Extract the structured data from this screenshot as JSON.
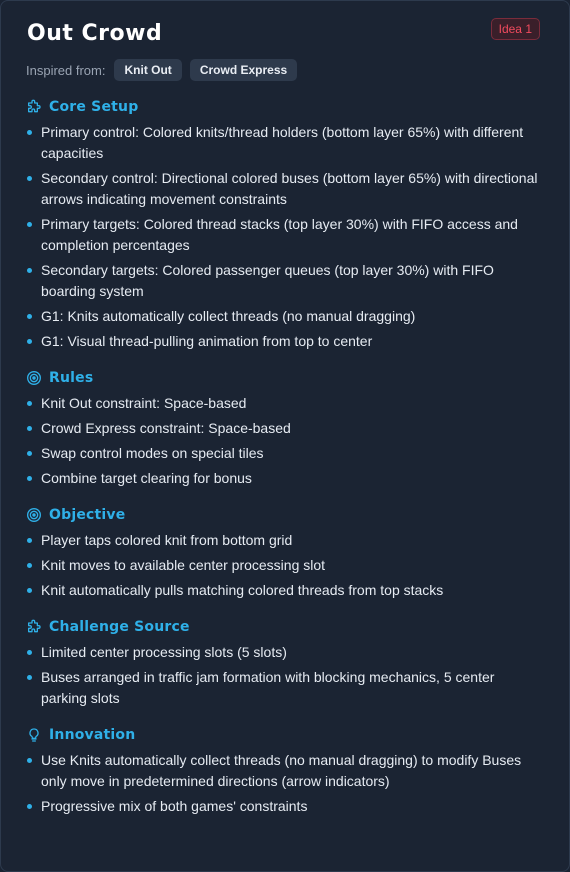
{
  "header": {
    "title": "Out Crowd",
    "badge": "Idea 1"
  },
  "inspired": {
    "label": "Inspired from:",
    "games": [
      "Knit Out",
      "Crowd Express"
    ]
  },
  "sections": [
    {
      "title": "Core Setup",
      "icon": "puzzle-icon",
      "items": [
        "Primary control: Colored knits/thread holders (bottom layer 65%) with different capacities",
        "Secondary control: Directional colored buses (bottom layer 65%) with directional arrows indicating movement constraints",
        "Primary targets: Colored thread stacks (top layer 30%) with FIFO access and completion percentages",
        "Secondary targets: Colored passenger queues (top layer 30%) with FIFO boarding system",
        "G1: Knits automatically collect threads (no manual dragging)",
        "G1: Visual thread-pulling animation from top to center"
      ]
    },
    {
      "title": "Rules",
      "icon": "target-icon",
      "items": [
        "Knit Out constraint: Space-based",
        "Crowd Express constraint: Space-based",
        "Swap control modes on special tiles",
        "Combine target clearing for bonus"
      ]
    },
    {
      "title": "Objective",
      "icon": "target-icon",
      "items": [
        "Player taps colored knit from bottom grid",
        "Knit moves to available center processing slot",
        "Knit automatically pulls matching colored threads from top stacks"
      ]
    },
    {
      "title": "Challenge Source",
      "icon": "puzzle-icon",
      "items": [
        "Limited center processing slots (5 slots)",
        "Buses arranged in traffic jam formation with blocking mechanics, 5 center parking slots"
      ]
    },
    {
      "title": "Innovation",
      "icon": "lightbulb-icon",
      "items": [
        "Use Knits automatically collect threads (no manual dragging) to modify Buses only move in predetermined directions (arrow indicators)",
        "Progressive mix of both games' constraints"
      ]
    }
  ],
  "colors": {
    "accent": "#2fb0e8",
    "badge": "#f24b5e",
    "background": "#1b2433"
  }
}
